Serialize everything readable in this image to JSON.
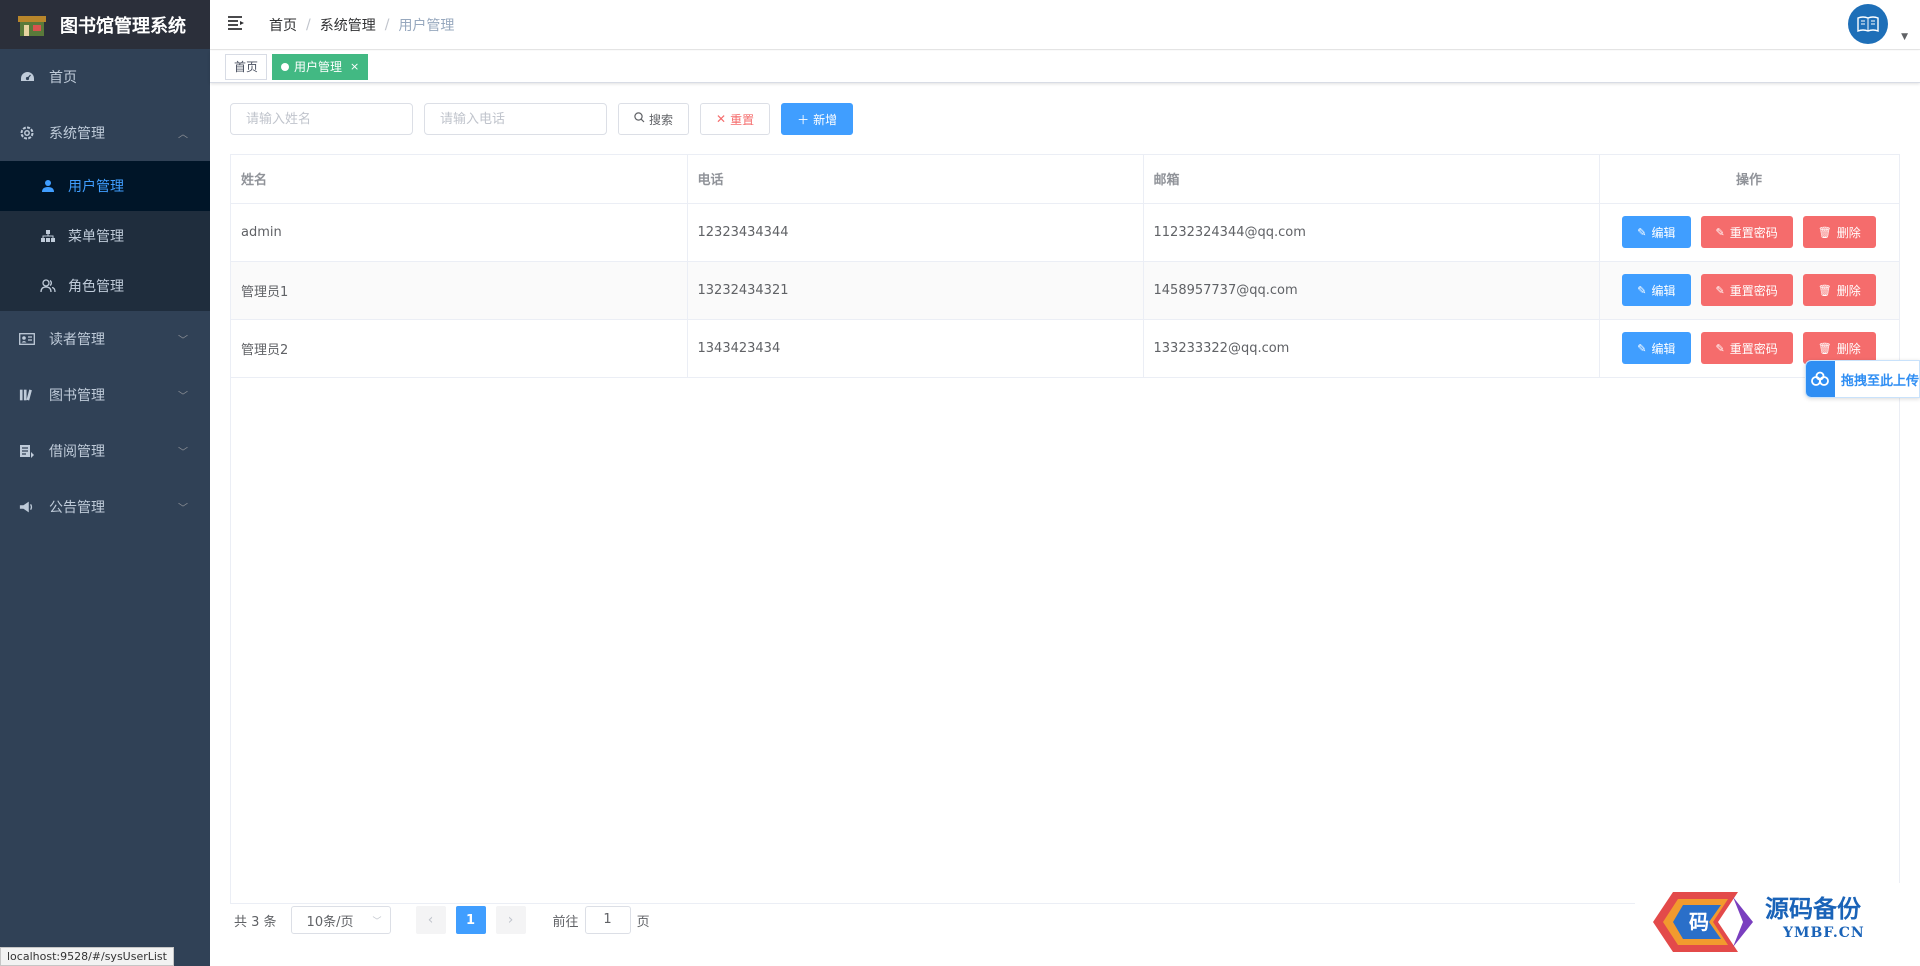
{
  "app": {
    "title": "图书馆管理系统"
  },
  "sidebar": {
    "items": [
      {
        "label": "首页",
        "icon": "dashboard-icon"
      },
      {
        "label": "系统管理",
        "icon": "gear-icon",
        "expanded": true,
        "children": [
          {
            "label": "用户管理",
            "icon": "user-icon",
            "active": true
          },
          {
            "label": "菜单管理",
            "icon": "tree-icon"
          },
          {
            "label": "角色管理",
            "icon": "people-icon"
          }
        ]
      },
      {
        "label": "读者管理",
        "icon": "id-card-icon"
      },
      {
        "label": "图书管理",
        "icon": "books-icon"
      },
      {
        "label": "借阅管理",
        "icon": "borrow-icon"
      },
      {
        "label": "公告管理",
        "icon": "announce-icon"
      }
    ]
  },
  "header": {
    "breadcrumb": [
      "首页",
      "系统管理",
      "用户管理"
    ]
  },
  "tags": [
    {
      "label": "首页",
      "active": false
    },
    {
      "label": "用户管理",
      "active": true,
      "close": "×"
    }
  ],
  "filters": {
    "name_placeholder": "请输入姓名",
    "phone_placeholder": "请输入电话",
    "search_label": "搜索",
    "reset_label": "重置",
    "add_label": "新增"
  },
  "table": {
    "columns": [
      "姓名",
      "电话",
      "邮箱",
      "操作"
    ],
    "rows": [
      {
        "name": "admin",
        "phone": "12323434344",
        "email": "11232324344@qq.com"
      },
      {
        "name": "管理员1",
        "phone": "13232434321",
        "email": "1458957737@qq.com"
      },
      {
        "name": "管理员2",
        "phone": "1343423434",
        "email": "133233322@qq.com"
      }
    ],
    "actions": {
      "edit": "编辑",
      "reset_pwd": "重置密码",
      "delete": "删除"
    }
  },
  "pagination": {
    "total": "共 3 条",
    "page_size": "10条/页",
    "current_page": "1",
    "jump_prefix": "前往",
    "jump_value": "1",
    "jump_suffix": "页"
  },
  "upload_widget": {
    "label": "拖拽至此上传"
  },
  "statusbar": {
    "url": "localhost:9528/#/sysUserList"
  },
  "watermark": {
    "line1": "源码备份",
    "line2": "YMBF.CN"
  },
  "colors": {
    "primary": "#409eff",
    "danger": "#f56c6c",
    "success": "#42b983",
    "sidebar": "#304156"
  }
}
